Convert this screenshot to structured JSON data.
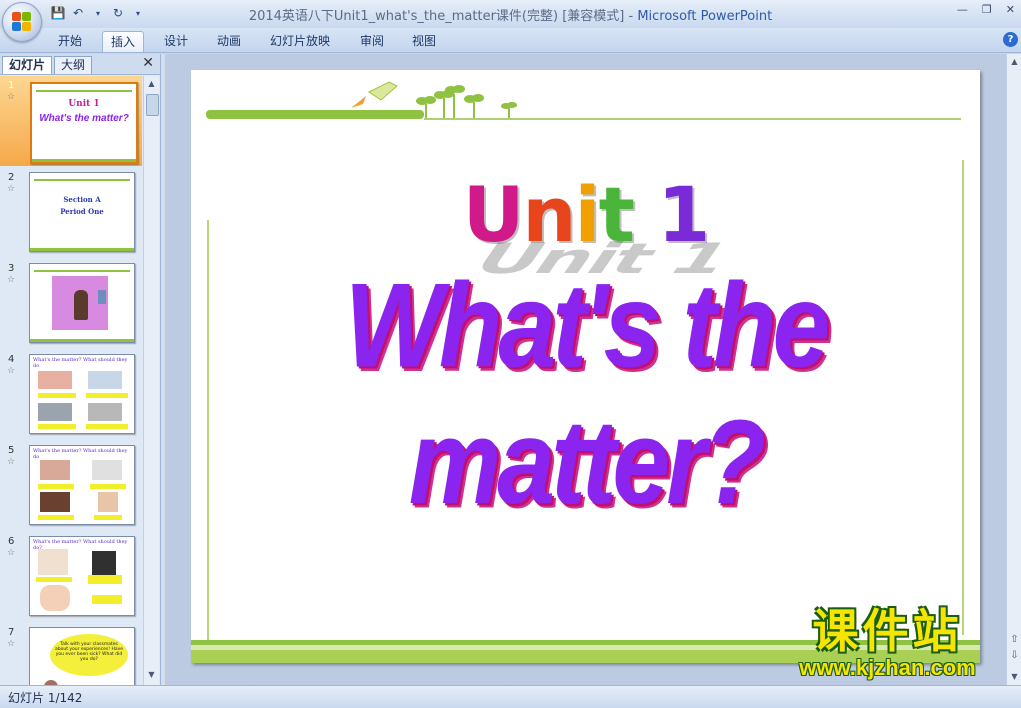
{
  "window": {
    "title": "2014英语八下Unit1_what's_the_matter课件(完整) [兼容模式] - Microsoft PowerPoint",
    "title_doc": "2014英语八下Unit1_what's_the_matter课件(完整) [兼容模式]",
    "title_sep": " - ",
    "title_app": "Microsoft PowerPoint"
  },
  "ribbon": {
    "tabs": [
      "开始",
      "插入",
      "设计",
      "动画",
      "幻灯片放映",
      "审阅",
      "视图"
    ],
    "active_tab": "插入"
  },
  "left_pane": {
    "tabs": [
      "幻灯片",
      "大纲"
    ],
    "active_tab": "幻灯片",
    "slides": [
      {
        "num": "1",
        "line1": "Unit 1",
        "line2": "What's the matter?"
      },
      {
        "num": "2",
        "line1": "Section A",
        "line2": "Period One"
      },
      {
        "num": "3"
      },
      {
        "num": "4",
        "line1": "What's the matter? What should they do"
      },
      {
        "num": "5",
        "line1": "What's the matter? What should they do"
      },
      {
        "num": "6",
        "line1": "What's the matter? What should they do?"
      },
      {
        "num": "7",
        "line1": "Talk with your classmates about your experiences! Have you ever been sick? What did you do?"
      }
    ]
  },
  "slide": {
    "title": "Unit 1",
    "title_letters": [
      {
        "ch": "U",
        "color": "#d11a8a"
      },
      {
        "ch": "n",
        "color": "#e8451c"
      },
      {
        "ch": "i",
        "color": "#f0a000"
      },
      {
        "ch": "t",
        "color": "#4bb43a"
      },
      {
        "ch": " ",
        "color": "#000000"
      },
      {
        "ch": "1",
        "color": "#7a2ad6"
      }
    ],
    "subtitle": "What's the matter?"
  },
  "status": {
    "slide_counter": "幻灯片 1/142"
  },
  "watermark": {
    "cn": "课件站",
    "url": "www.kjzhan.com"
  },
  "colors": {
    "accent_green": "#8fc241",
    "subtitle_purple": "#8a24ee",
    "selection_orange": "#f6a84a"
  }
}
